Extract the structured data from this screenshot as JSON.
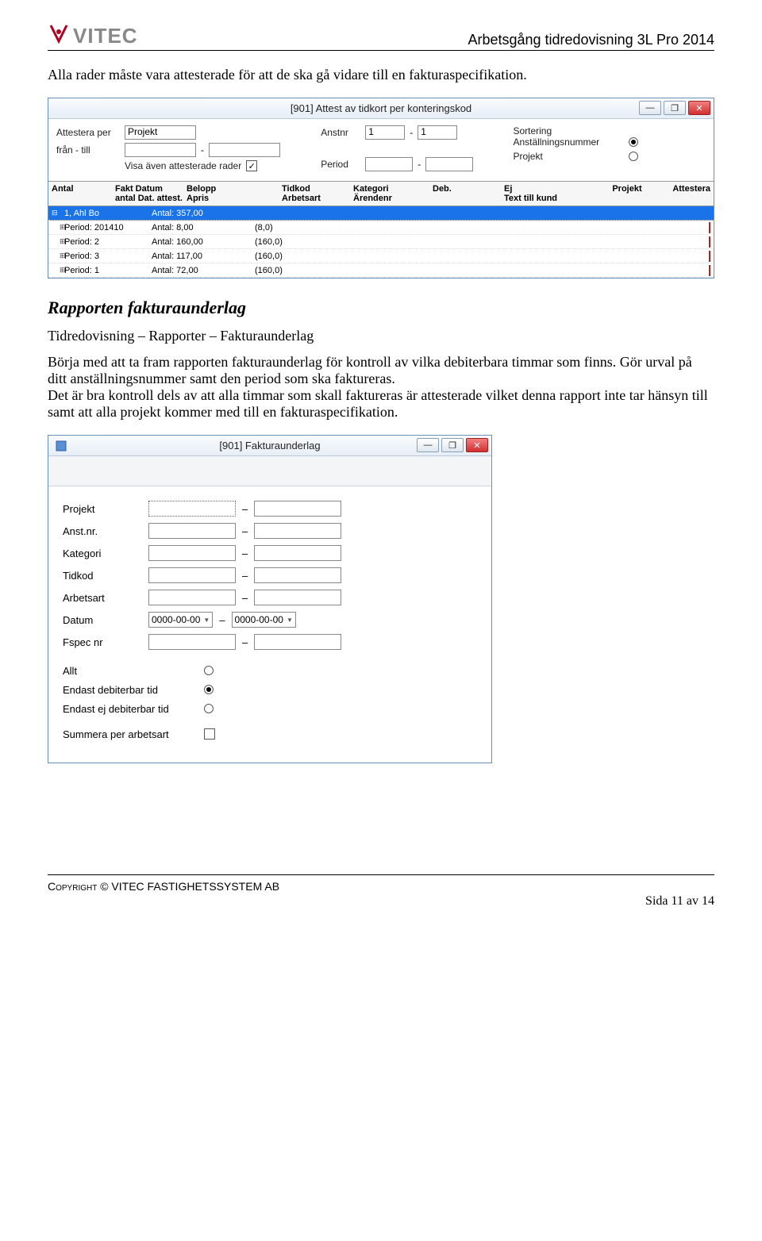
{
  "header": {
    "logo_text": "VITEC",
    "doc_title": "Arbetsgång tidredovisning 3L Pro 2014"
  },
  "intro_text": "Alla rader måste vara attesterade för att de ska gå vidare till en fakturaspecifikation.",
  "win1": {
    "title": "[901]  Attest av tidkort per konteringskod",
    "min": "—",
    "restore": "❐",
    "close": "✕",
    "labels": {
      "attestera_per": "Attestera per",
      "projekt": "Projekt",
      "fran_till": "från - till",
      "dash": "-",
      "visa_attesterade": "Visa även attesterade rader",
      "anstnr": "Anstnr",
      "anstnr_from": "1",
      "anstnr_to": "1",
      "period": "Period",
      "sortering": "Sortering",
      "sort_opt1": "Anställningsnummer",
      "sort_opt2": "Projekt"
    },
    "grid_header": {
      "c1": "Antal",
      "c2a": "Fakt Datum",
      "c2b": "antal Dat. attest.",
      "c3a": "Belopp",
      "c3b": "Apris",
      "c4a": "Tidkod",
      "c4b": "Arbetsart",
      "c5a": "Kategori",
      "c5b": "Ärendenr",
      "c6": "Deb.",
      "c7": "Ej",
      "c8": "Text till kund",
      "c9": "Projekt",
      "c10": "Attestera"
    },
    "rows": [
      {
        "expander": "⊟",
        "label": "1, Ahl Bo",
        "antal": "Antal: 357,00",
        "val": "",
        "sel": true,
        "icon": "person"
      },
      {
        "expander": "⊞",
        "label": "Period: 201410",
        "antal": "Antal: 8,00",
        "val": "(8,0)",
        "sel": false,
        "icon": "cal"
      },
      {
        "expander": "⊞",
        "label": "Period: 2",
        "antal": "Antal: 160,00",
        "val": "(160,0)",
        "sel": false,
        "icon": "cal"
      },
      {
        "expander": "⊞",
        "label": "Period: 3",
        "antal": "Antal: 117,00",
        "val": "(160,0)",
        "sel": false,
        "icon": "cal"
      },
      {
        "expander": "⊞",
        "label": "Period: 1",
        "antal": "Antal: 72,00",
        "val": "(160,0)",
        "sel": false,
        "icon": "cal"
      }
    ]
  },
  "section_heading": "Rapporten fakturaunderlag",
  "breadcrumb": "Tidredovisning – Rapporter – Fakturaunderlag",
  "body2a": "Börja med att ta fram rapporten fakturaunderlag för kontroll av vilka debiterbara timmar som finns. Gör urval på ditt anställningsnummer samt den period som ska faktureras.",
  "body2b": "Det är bra kontroll dels av att alla timmar som skall faktureras är attesterade vilket denna rapport inte tar hänsyn till samt att alla projekt kommer med till en fakturaspecifikation.",
  "win2": {
    "title": "[901]  Fakturaunderlag",
    "min": "—",
    "restore": "❐",
    "close": "✕",
    "labels": {
      "projekt": "Projekt",
      "anstnr": "Anst.nr.",
      "kategori": "Kategori",
      "tidkod": "Tidkod",
      "arbetsart": "Arbetsart",
      "datum": "Datum",
      "fspec": "Fspec nr",
      "date_from": "0000-00-00",
      "date_to": "0000-00-00",
      "dash": "–",
      "allt": "Allt",
      "endast_deb": "Endast debiterbar tid",
      "endast_ej": "Endast ej debiterbar tid",
      "summera": "Summera per arbetsart"
    }
  },
  "footer": {
    "copyright": "Copyright © VITEC FASTIGHETSSYSTEM AB",
    "page": "Sida 11 av 14"
  }
}
